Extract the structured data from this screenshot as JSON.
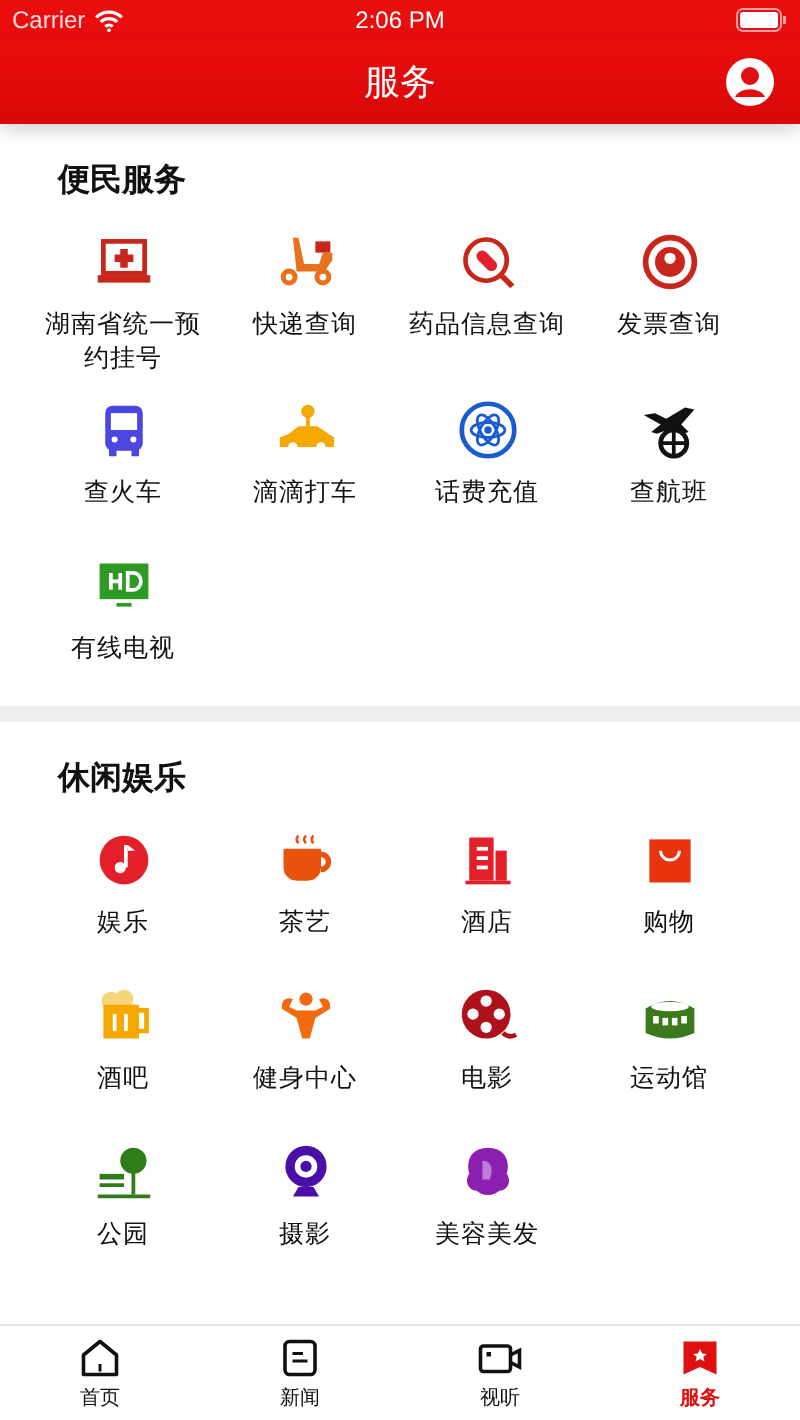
{
  "status_bar": {
    "carrier": "Carrier",
    "time": "2:06 PM"
  },
  "header": {
    "title": "服务"
  },
  "sections": [
    {
      "title": "便民服务",
      "items": [
        {
          "label": "湖南省统一预约挂号"
        },
        {
          "label": "快递查询"
        },
        {
          "label": "药品信息查询"
        },
        {
          "label": "发票查询"
        },
        {
          "label": "查火车"
        },
        {
          "label": "滴滴打车"
        },
        {
          "label": "话费充值"
        },
        {
          "label": "查航班"
        },
        {
          "label": "有线电视"
        }
      ]
    },
    {
      "title": "休闲娱乐",
      "items": [
        {
          "label": "娱乐"
        },
        {
          "label": "茶艺"
        },
        {
          "label": "酒店"
        },
        {
          "label": "购物"
        },
        {
          "label": "酒吧"
        },
        {
          "label": "健身中心"
        },
        {
          "label": "电影"
        },
        {
          "label": "运动馆"
        },
        {
          "label": "公园"
        },
        {
          "label": "摄影"
        },
        {
          "label": "美容美发"
        }
      ]
    }
  ],
  "tabs": [
    {
      "label": "首页",
      "selected": false
    },
    {
      "label": "新闻",
      "selected": false
    },
    {
      "label": "视听",
      "selected": false
    },
    {
      "label": "服务",
      "selected": true
    }
  ]
}
